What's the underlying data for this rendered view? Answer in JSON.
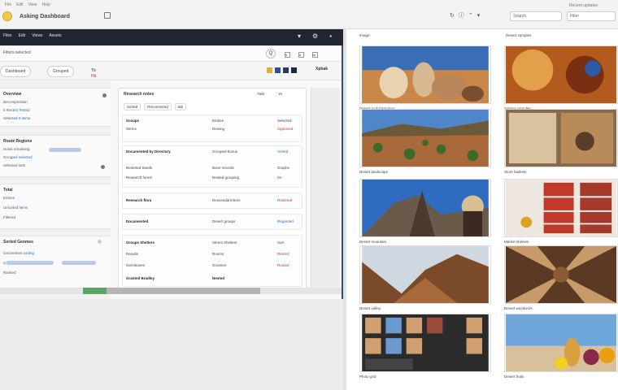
{
  "topbar": {
    "menu": [
      "File",
      "Edit",
      "View",
      "Help"
    ],
    "app_title": "Asking Dashboard",
    "tools": [
      "↻",
      "ⓘ",
      "⌃",
      "▾"
    ],
    "search_text": "Search",
    "right_text": "Recent updates",
    "field_text": "Filter"
  },
  "darkbar": {
    "menu": [
      "Files",
      "Edit",
      "Views",
      "Assets"
    ],
    "icons": [
      "▾",
      "⚙",
      "▪"
    ]
  },
  "toolbar1": {
    "label": "Filters selected",
    "icon": "Q",
    "badges": [
      "b",
      "d",
      "m"
    ]
  },
  "toolbar2": {
    "tabs": [
      "Dashboard",
      "Grouped"
    ],
    "small_a": "Tb",
    "small_b": "Hb",
    "right_label": "Xpbak",
    "colors": [
      "#e1b13a",
      "#2f4f9e",
      "#2a3a66",
      "#1e2a44"
    ]
  },
  "sidebar": {
    "sections": [
      {
        "head": "Overview",
        "rows": [
          {
            "a": "Decomposition",
            "b": ""
          },
          {
            "a": "5 Recent",
            "b": "Tested"
          },
          {
            "a": "Selected",
            "b": "0 items"
          }
        ]
      },
      {
        "head": "Route Regions",
        "rows": [
          {
            "a": "Hosts remaining",
            "b": ""
          },
          {
            "a": "Grouped",
            "b": "selected"
          },
          {
            "a": "Selected sets",
            "b": ""
          }
        ]
      },
      {
        "head": "Total",
        "rows": [
          {
            "a": "Entries",
            "b": ""
          },
          {
            "a": "Unsorted",
            "b": "items"
          },
          {
            "a": "Filtered",
            "b": ""
          }
        ]
      },
      {
        "head": "Sorted Geomes",
        "rows": [
          {
            "a": "Geometries",
            "b": "sorting"
          },
          {
            "a": "Completed",
            "b": ""
          },
          {
            "a": "Ranked",
            "b": ""
          }
        ]
      }
    ]
  },
  "table": {
    "title": "Research notes",
    "tabs": [
      "Sorted",
      "Recommend",
      "tab"
    ],
    "top_right": [
      "Yakk",
      "Ye"
    ],
    "rows": [
      {
        "c1": "Groups",
        "c2": "Entries",
        "c3": "Selected"
      },
      {
        "c1": "Stems",
        "c2": "Dewing",
        "c3": "Approved"
      },
      {
        "c1": "Documented by Directory",
        "c2": "Grouped bonus",
        "c3": "Sorted"
      },
      {
        "c1": "Deserted Seeds",
        "c2": "Bone records",
        "c3": "Graphs"
      },
      {
        "c1": "Research forest",
        "c2": "Nested grouping",
        "c3": "Xe"
      },
      {
        "c1": "Research flora",
        "c2": "Descendant Bors",
        "c3": "Rostered"
      },
      {
        "c1": "Documented",
        "c2": "Desert groups",
        "c3": "Regarded"
      },
      {
        "c1": "Groups Shelters",
        "c2": "Stems Shelters",
        "c3": "Sort"
      },
      {
        "c1": "Results",
        "c2": "Rooms",
        "c3": "Rented"
      },
      {
        "c1": "Gemstones",
        "c2": "Gnomes",
        "c3": "Rooted"
      },
      {
        "c1": "Granted Bradley",
        "c2": "Nested",
        "c3": ""
      }
    ]
  },
  "progress": {
    "green_fraction": 0.07,
    "grey_fraction": 0.45
  },
  "gallery": {
    "header_left": "Image",
    "header_right": "Desert samples",
    "items": [
      {
        "label": "Desert rock formation",
        "kind": "rocks"
      },
      {
        "label": "Sahara samples",
        "kind": "sand"
      },
      {
        "label": "Desert landscape",
        "kind": "plains"
      },
      {
        "label": "Store baskets",
        "kind": "baskets"
      },
      {
        "label": "Desert mountain",
        "kind": "mountain"
      },
      {
        "label": "Market shelves",
        "kind": "shelves"
      },
      {
        "label": "Desert valley",
        "kind": "valley"
      },
      {
        "label": "Desert woodwork",
        "kind": "wood"
      },
      {
        "label": "Photo grid",
        "kind": "grid"
      },
      {
        "label": "Desert fruits",
        "kind": "fruits"
      }
    ]
  }
}
